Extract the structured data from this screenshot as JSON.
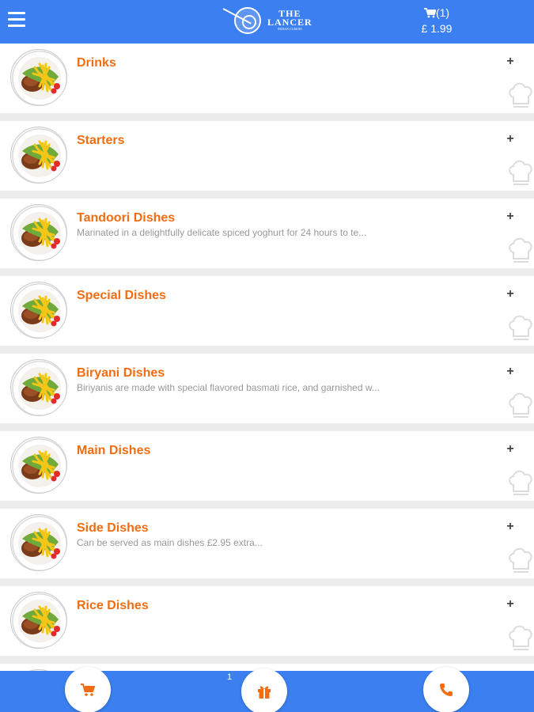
{
  "app": {
    "logo_line1": "THE",
    "logo_line2": "LANCER",
    "logo_tagline": "INDIAN CUISINE"
  },
  "cart": {
    "count": "(1)",
    "total": "£ 1.99"
  },
  "categories": [
    {
      "title": "Drinks",
      "description": ""
    },
    {
      "title": "Starters",
      "description": ""
    },
    {
      "title": "Tandoori Dishes",
      "description": "Marinated in a delightfully delicate spiced yoghurt for 24 hours to te..."
    },
    {
      "title": "Special Dishes",
      "description": ""
    },
    {
      "title": "Biryani Dishes",
      "description": "Biriyanis are made with special flavored basmati rice, and garnished w..."
    },
    {
      "title": "Main Dishes",
      "description": ""
    },
    {
      "title": "Side Dishes",
      "description": "Can be served as main dishes £2.95 extra..."
    },
    {
      "title": "Rice Dishes",
      "description": ""
    },
    {
      "title": "",
      "description": ""
    }
  ],
  "expand_symbol": "+",
  "bottom_bar": {
    "offers_count": "1"
  },
  "colors": {
    "header_blue": "#3b7ff0",
    "title_orange": "#f26d12",
    "description_gray": "#999999"
  },
  "icons": {
    "menu": "hamburger-icon",
    "cart": "cart-icon",
    "expand": "plus-icon",
    "chef": "chef-hat-icon",
    "bottom_cart": "cart-icon",
    "bottom_offers": "gift-icon",
    "bottom_call": "phone-icon"
  }
}
